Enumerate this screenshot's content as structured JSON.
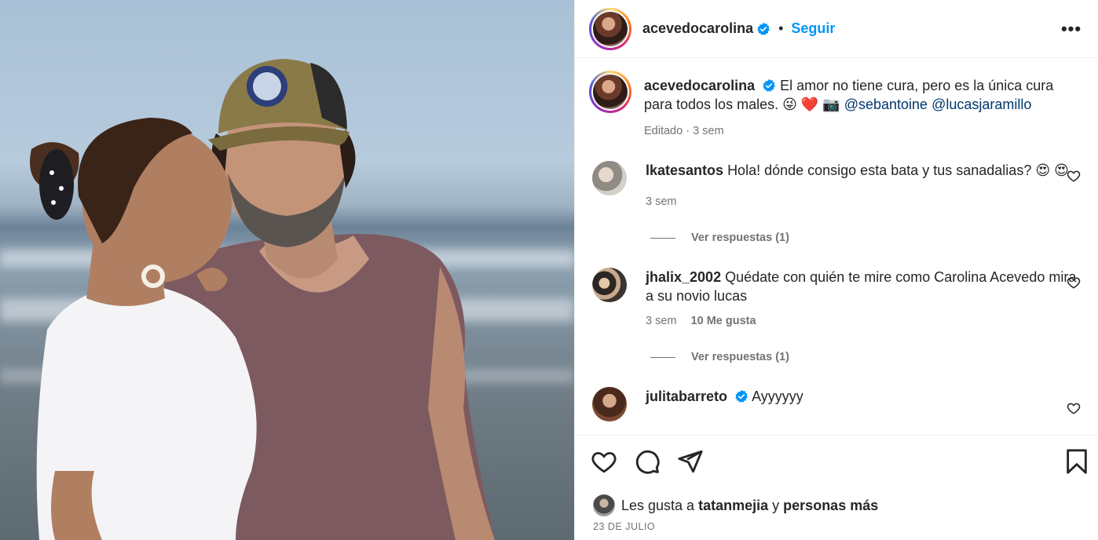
{
  "post": {
    "author": "acevedocarolina",
    "follow_label": "Seguir",
    "separator": "•",
    "more_label": "•••"
  },
  "caption": {
    "username": "acevedocarolina",
    "text": "El amor no tiene cura, pero es la única cura para todos los males. 😜 ❤️ 📷",
    "mention1": "@sebantoine",
    "mention2": "@lucasjaramillo",
    "meta": "Editado · 3 sem"
  },
  "comments": [
    {
      "username": "lkatesantos",
      "text": "Hola! dónde consigo esta bata y tus sanadalias? 😍 😍",
      "time": "3 sem",
      "likes": "",
      "replies": "Ver respuestas (1)"
    },
    {
      "username": "jhalix_2002",
      "text": "Quédate con quién te mire como Carolina Acevedo mira a su novio lucas",
      "time": "3 sem",
      "likes": "10 Me gusta",
      "replies": "Ver respuestas (1)"
    },
    {
      "username": "julitabarreto",
      "text": "Ayyyyyy",
      "verified": true
    }
  ],
  "likes": {
    "prefix": "Les gusta a",
    "user": "tatanmejia",
    "joiner": "y",
    "rest": "personas más"
  },
  "date": "23 DE JULIO",
  "icons": [
    "heart-icon",
    "comment-icon",
    "share-icon",
    "bookmark-icon",
    "verified-icon",
    "more-icon"
  ],
  "colors": {
    "accent": "#0095f6",
    "verified": "#0095f6",
    "muted": "#737373",
    "text": "#262626"
  }
}
